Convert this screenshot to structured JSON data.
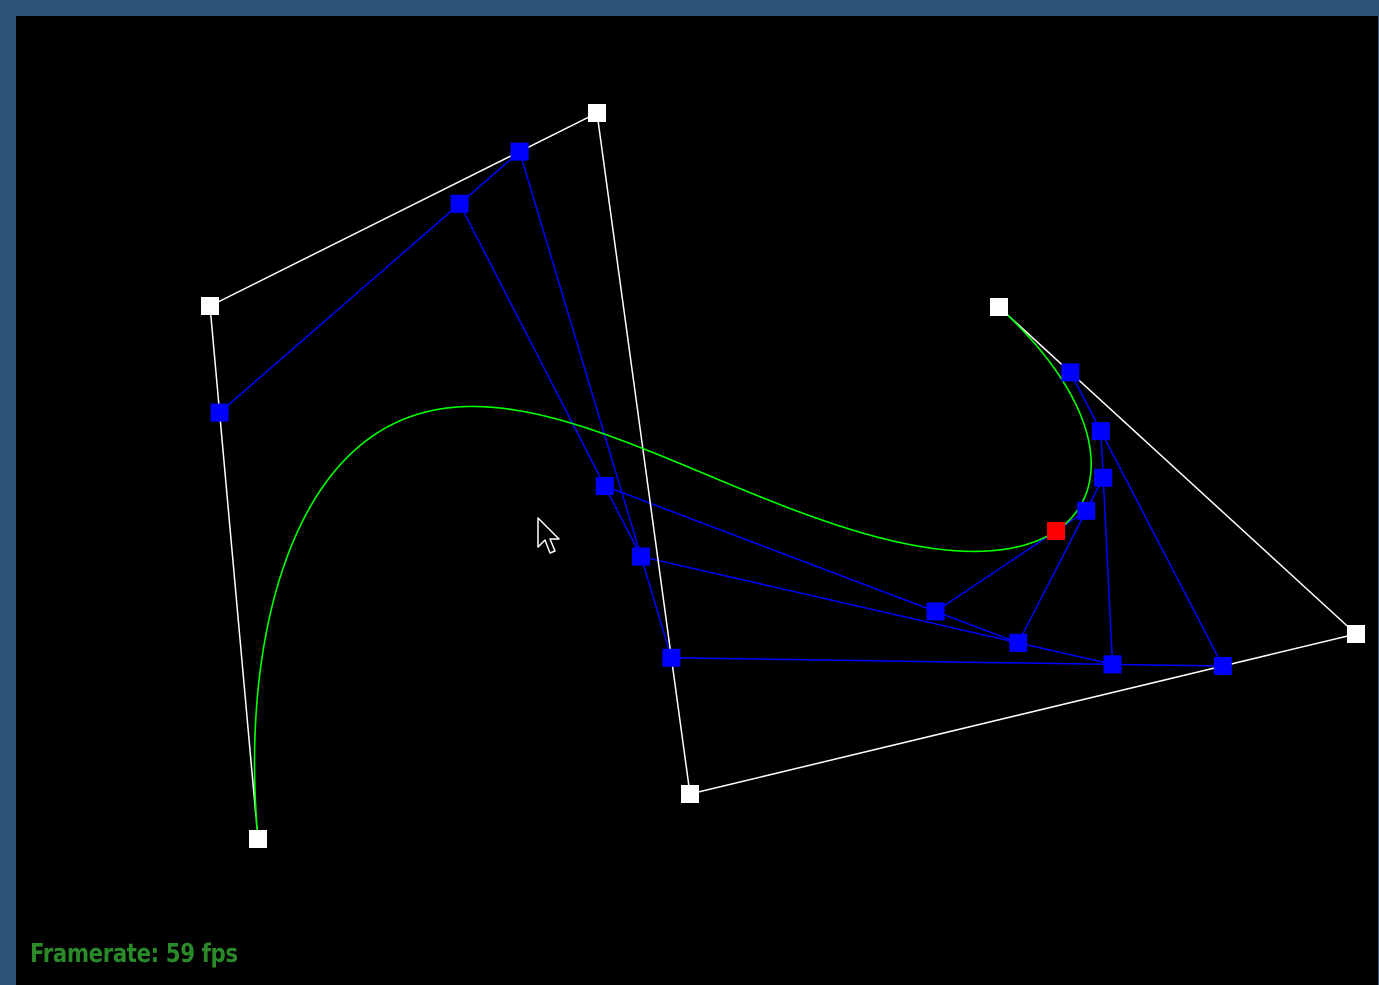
{
  "status": {
    "framerate_label": "Framerate: 59 fps"
  },
  "colors": {
    "background": "#000000",
    "frame": "#2b5378",
    "control_polygon": "#ffffff",
    "construction_lines": "#0000ff",
    "curve": "#00ff00",
    "current_point": "#ff0000",
    "text": "#2a8a2a"
  },
  "icons": {
    "cursor": "arrow-cursor-icon"
  }
}
